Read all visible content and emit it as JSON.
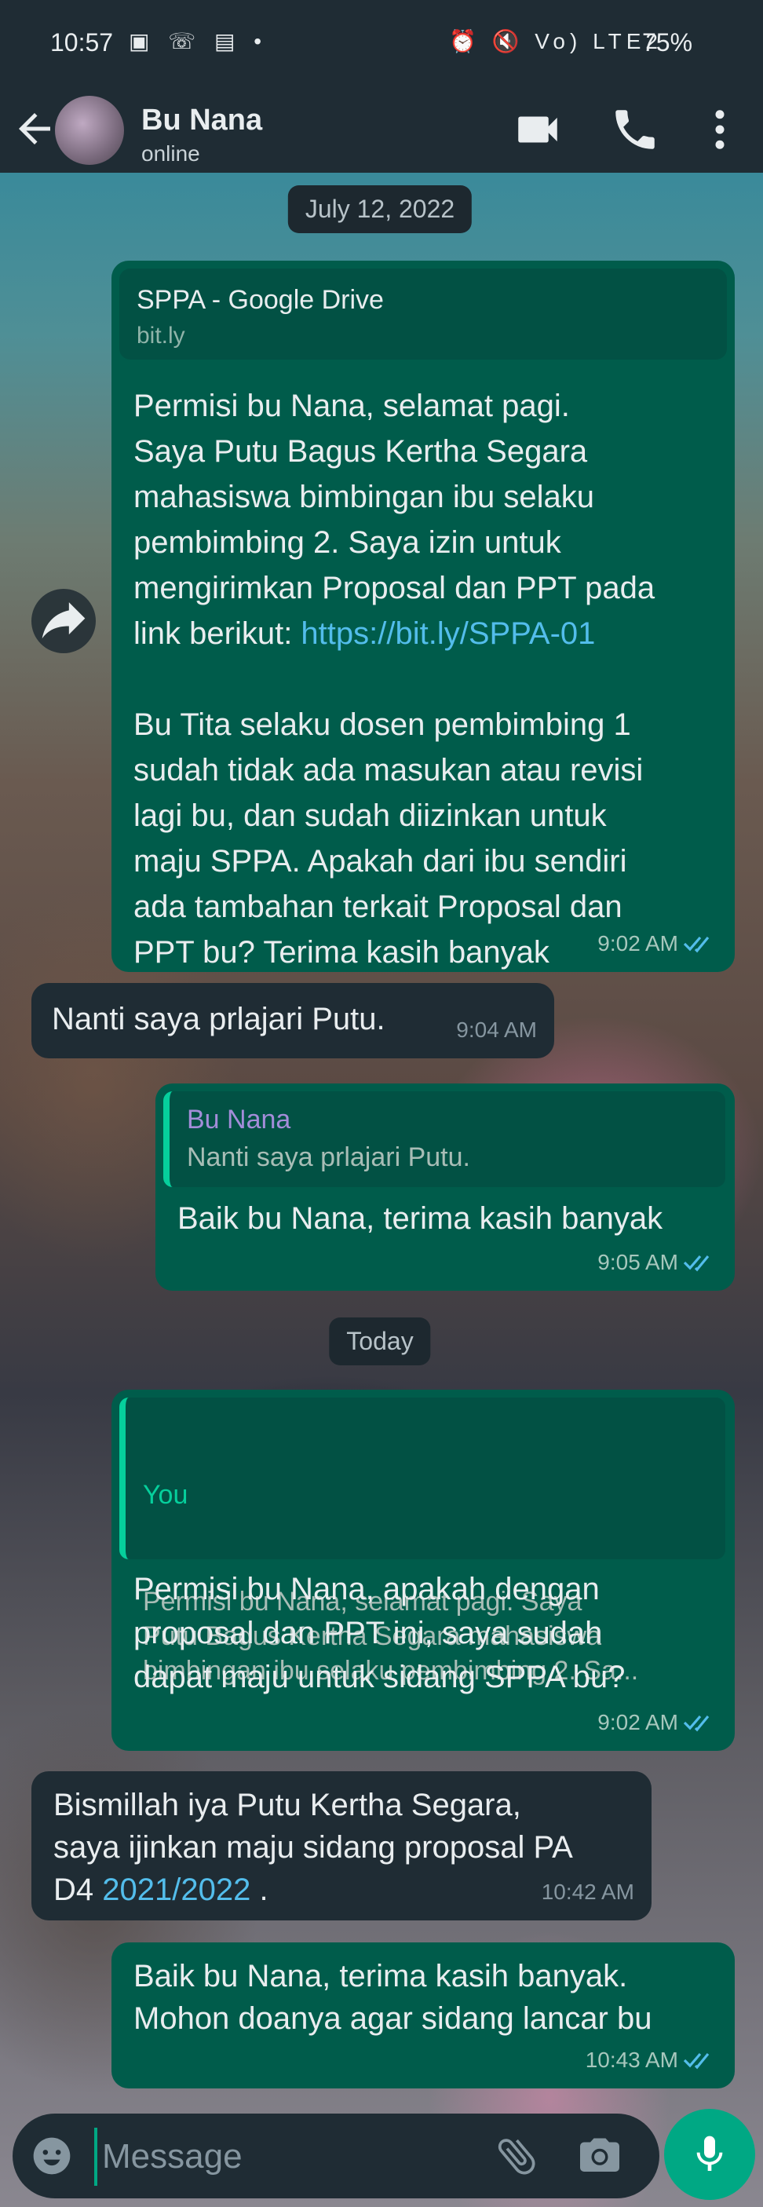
{
  "status_bar": {
    "time": "10:57",
    "left_icons": "▣ ☏ ▤ •",
    "right_icons": "⏰ 🔇 Vo) LTE2",
    "battery": "75%"
  },
  "header": {
    "name": "Bu Nana",
    "status": "online"
  },
  "chat": {
    "date_1": "July 12, 2022",
    "msg1": {
      "link_title": "SPPA - Google Drive",
      "link_domain": "bit.ly",
      "text_a": "Permisi bu Nana, selamat pagi.\nSaya Putu Bagus Kertha Segara\nmahasiswa bimbingan ibu selaku\npembimbing 2. Saya izin untuk\nmengirimkan Proposal dan PPT pada\nlink berikut: ",
      "link": "https://bit.ly/SPPA-01",
      "text_b": "Bu Tita selaku dosen pembimbing 1\nsudah tidak ada masukan atau revisi\nlagi bu, dan sudah diizinkan untuk\nmaju SPPA. Apakah dari ibu sendiri\nada tambahan terkait Proposal dan\nPPT bu? Terima kasih banyak",
      "time": "9:02 AM"
    },
    "msg2": {
      "text": "Nanti saya prlajari Putu.",
      "time": "9:04 AM"
    },
    "msg3": {
      "quote_author": "Bu Nana",
      "quote_text": "Nanti saya prlajari Putu.",
      "text": "Baik bu Nana, terima kasih banyak",
      "time": "9:05 AM"
    },
    "date_2": "Today",
    "msg4": {
      "quote_author": "You",
      "quote_text": "Permisi bu Nana, selamat pagi. Saya\nPutu Bagus Kertha Segara mahasiswa\nbimbingan ibu selaku pembimbing 2. Sa...",
      "text": "Permisi bu Nana, apakah dengan\nproposal dan PPT ini, saya sudah\ndapat maju untuk sidang SPPA bu?",
      "time": "9:02 AM"
    },
    "msg5": {
      "text_a": "Bismillah iya Putu Kertha Segara,\nsaya ijinkan maju sidang proposal PA\nD4 ",
      "link": "2021/2022",
      "text_b": " .",
      "time": "10:42 AM"
    },
    "msg6": {
      "text": "Baik bu Nana, terima kasih banyak.\nMohon doanya agar sidang lancar bu",
      "time": "10:43 AM"
    }
  },
  "composer": {
    "placeholder": "Message"
  },
  "colors": {
    "outgoing": "#005c4b",
    "incoming": "#1f2c34",
    "accent": "#00a884",
    "link": "#53bdeb",
    "read_ticks": "#53bdeb"
  },
  "icons": [
    "back-arrow-icon",
    "video-call-icon",
    "phone-icon",
    "more-vert-icon",
    "forward-icon",
    "emoji-icon",
    "attach-icon",
    "camera-icon",
    "mic-icon",
    "double-check-icon"
  ]
}
